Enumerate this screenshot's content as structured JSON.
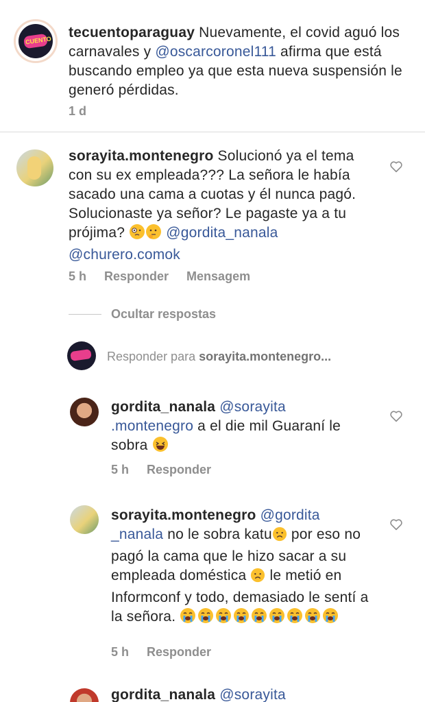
{
  "post": {
    "username": "tecuentoparaguay",
    "text_before": " Nuevamente, el covid aguó los carnavales y ",
    "mention": "@oscarcoronel111",
    "text_after": " afirma que está buscando empleo ya que esta nueva suspensión le generó pérdidas.",
    "time": "1 d",
    "avatar_logo": "CUENTO",
    "avatar_logo_small": "TE"
  },
  "comment1": {
    "username": "sorayita.montenegro",
    "text": " Solucionó ya el tema con su ex empleada??? La señora le había sacado una cama a cuotas y él nunca pagó. Solucionaste ya señor? Le pagaste ya a tu prójima? ",
    "mention1": "@gordita_nanala",
    "mention2": "@churero.comok",
    "emojis": [
      "face-with-monocle",
      "thinking-face"
    ],
    "time": "5 h",
    "reply_label": "Responder",
    "message_label": "Mensagem"
  },
  "hide_replies_label": "Ocultar respostas",
  "reply_input": {
    "prefix": "Responder para ",
    "target": "sorayita.montenegro..."
  },
  "reply1": {
    "username": "gordita_nanala",
    "mention_a": "@sorayita",
    "mention_b": ".montenegro",
    "text": " a el die mil Guaraní le sobra ",
    "emoji": "grinning-squinting-face",
    "time": "5 h",
    "reply_label": "Responder"
  },
  "reply2": {
    "username": "sorayita.montenegro",
    "mention_a": "@gordita",
    "mention_b": "_nanala",
    "text1": " no le sobra katu",
    "text2": " por eso no pagó la cama que le hizo sacar a su empleada doméstica ",
    "text3": " le metió en Informconf y todo, demasiado le sentí a la señora. ",
    "emojis": [
      "sad-face",
      "sad-face",
      "crying-face-x9"
    ],
    "time": "5 h",
    "reply_label": "Responder"
  },
  "reply3": {
    "username": "gordita_nanala",
    "mention": "@sorayita"
  },
  "colors": {
    "text": "#262626",
    "mention": "#385898",
    "meta": "#8e8e8e",
    "divider": "#dbdbdb"
  }
}
